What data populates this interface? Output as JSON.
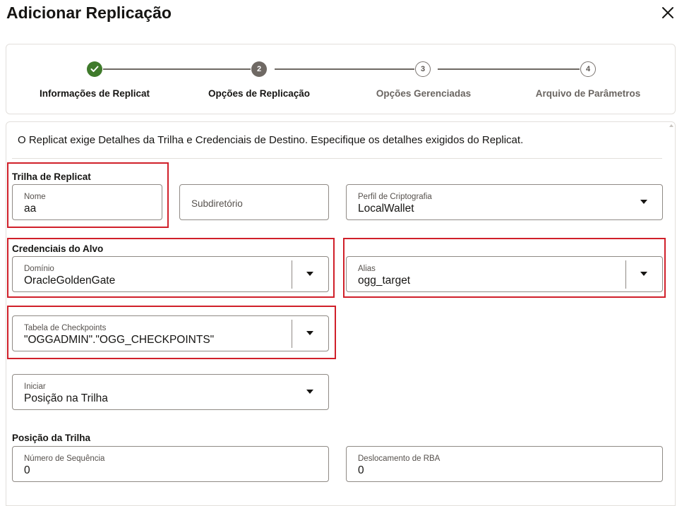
{
  "dialog": {
    "title": "Adicionar Replicação",
    "close_icon": "close-icon"
  },
  "stepper": {
    "steps": [
      {
        "number": "1",
        "label": "Informações de Replicat",
        "state": "completed",
        "icon": "check-icon"
      },
      {
        "number": "2",
        "label": "Opções de Replicação",
        "state": "active"
      },
      {
        "number": "3",
        "label": "Opções Gerenciadas",
        "state": "pending"
      },
      {
        "number": "4",
        "label": "Arquivo de Parâmetros",
        "state": "pending"
      }
    ]
  },
  "form": {
    "intro": "O Replicat exige Detalhes da Trilha e Credenciais de Destino. Especifique os detalhes exigidos do Replicat.",
    "trail_section": {
      "label": "Trilha de Replicat",
      "nome": {
        "label": "Nome",
        "value": "aa"
      },
      "subdiretorio": {
        "placeholder": "Subdiretório"
      },
      "perfil": {
        "label": "Perfil de Criptografia",
        "value": "LocalWallet"
      }
    },
    "credentials_section": {
      "label": "Credenciais do Alvo",
      "dominio": {
        "label": "Domínio",
        "value": "OracleGoldenGate"
      },
      "alias": {
        "label": "Alias",
        "value": "ogg_target"
      }
    },
    "checkpoint": {
      "label": "Tabela de Checkpoints",
      "value": "\"OGGADMIN\".\"OGG_CHECKPOINTS\""
    },
    "iniciar": {
      "label": "Iniciar",
      "value": "Posição na Trilha"
    },
    "trail_position": {
      "label": "Posição da Trilha",
      "sequencia": {
        "label": "Número de Sequência",
        "value": "0"
      },
      "rba": {
        "label": "Deslocamento de RBA",
        "value": "0"
      }
    }
  },
  "colors": {
    "highlight": "#d0202a",
    "step_done": "#3f7a2b",
    "step_active": "#6f6964",
    "border": "#8f8a85"
  }
}
